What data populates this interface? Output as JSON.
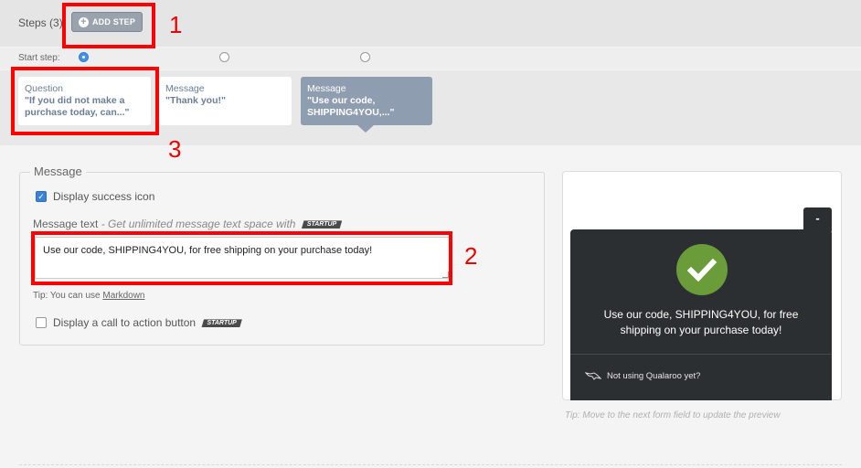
{
  "header": {
    "steps_label": "Steps (3)",
    "add_step_label": "ADD STEP",
    "start_step_label": "Start step:"
  },
  "steps": [
    {
      "type": "Question",
      "text": "\"If you did not make a purchase today, can...\"",
      "start": true
    },
    {
      "type": "Message",
      "text": "\"Thank you!\"",
      "start": false
    },
    {
      "type": "Message",
      "text": "\"Use our code, SHIPPING4YOU,...\"",
      "start": false,
      "selected": true
    }
  ],
  "editor": {
    "legend": "Message",
    "success_icon_label": "Display success icon",
    "success_icon_checked": true,
    "message_text_label": "Message text",
    "message_text_hint": " - Get unlimited message text space with",
    "startup_badge": "STARTUP",
    "message_text_value": "Use our code, SHIPPING4YOU, for free shipping on your purchase today!",
    "tip_prefix": "Tip: You can use ",
    "tip_link": "Markdown",
    "cta_label": "Display a call to action button",
    "cta_checked": false
  },
  "preview": {
    "minimize_label": "-",
    "message": "Use our code, SHIPPING4YOU, for free shipping on your purchase today!",
    "footer": "Not using Qualaroo yet?",
    "tip": "Tip: Move to the next form field to update the preview"
  },
  "annotations": [
    "1",
    "2",
    "3"
  ],
  "colors": {
    "annotation": "#ff0000",
    "success": "#6a9c3a",
    "widget_bg": "#2b2f31",
    "selected_card": "#8f9db0"
  }
}
